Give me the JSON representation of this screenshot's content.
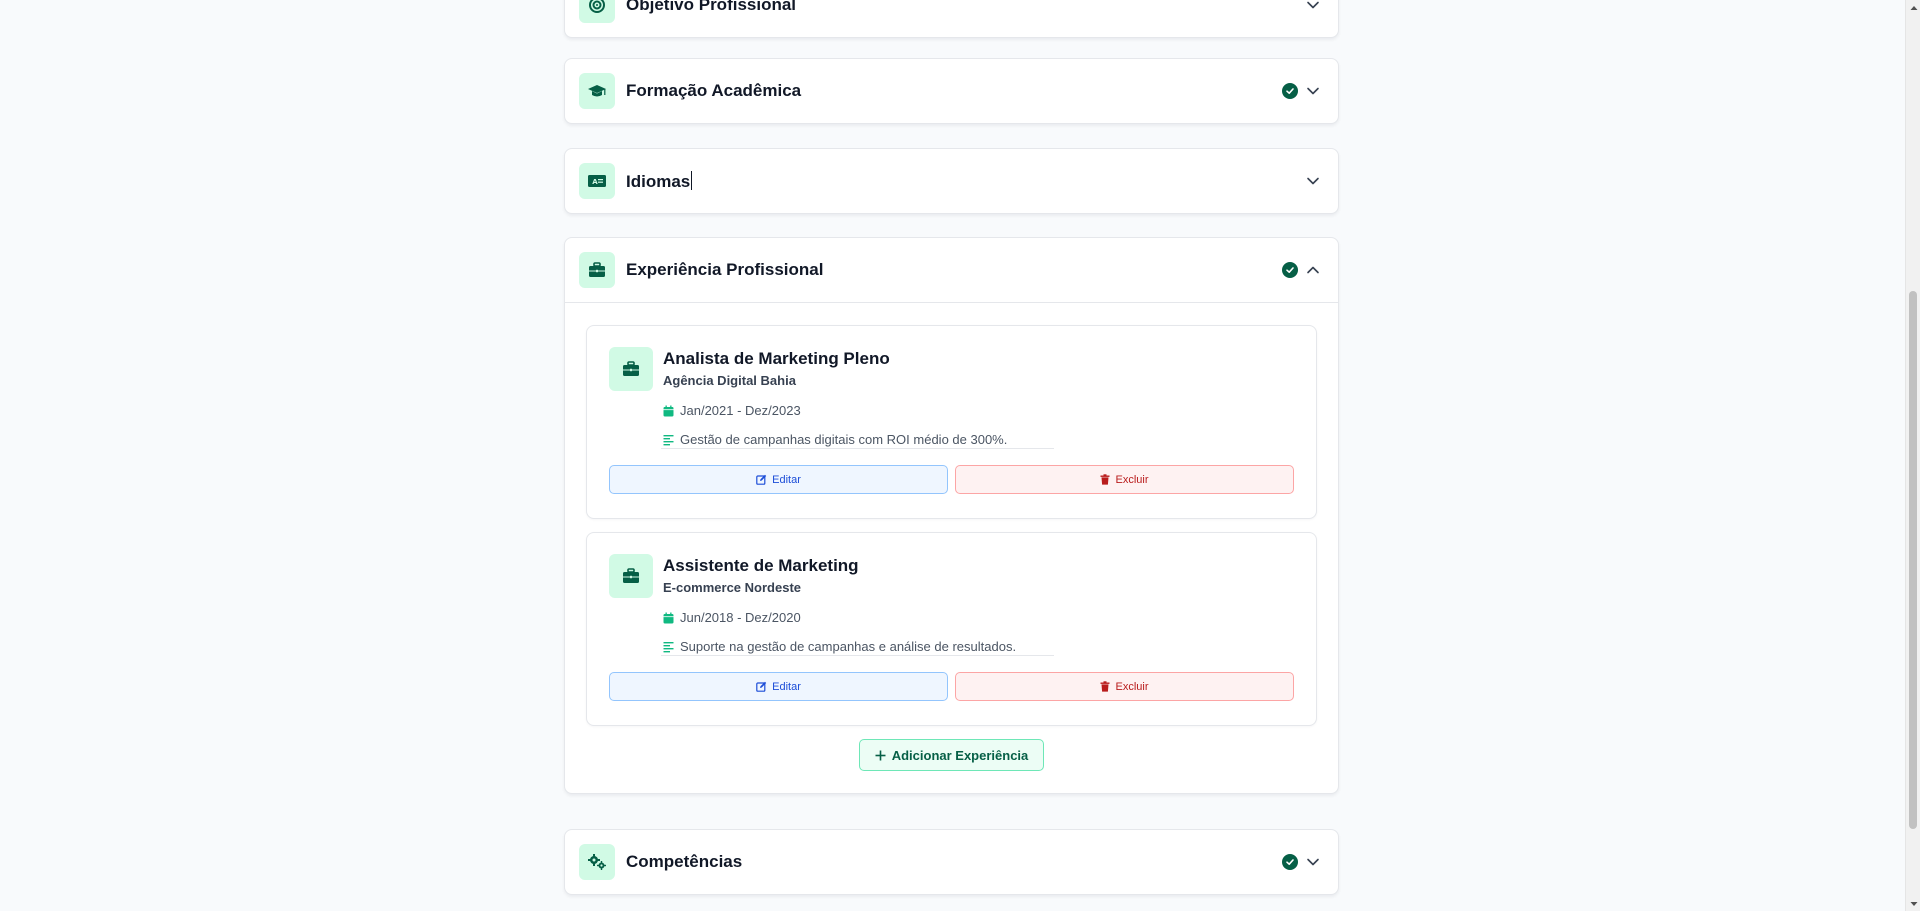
{
  "sections": {
    "objetivo": {
      "title": "Objetivo Profissional",
      "icon": "bullseye-icon"
    },
    "formacao": {
      "title": "Formação Acadêmica",
      "icon": "graduation-cap-icon",
      "completed": true
    },
    "idiomas": {
      "title": "Idiomas",
      "icon": "language-icon"
    },
    "experiencia": {
      "title": "Experiência Profissional",
      "icon": "briefcase-icon",
      "completed": true,
      "expanded": true,
      "items": [
        {
          "title": "Analista de Marketing Pleno",
          "company": "Agência Digital Bahia",
          "period": "Jan/2021 - Dez/2023",
          "description": "Gestão de campanhas digitais com ROI médio de 300%.",
          "edit_label": "Editar",
          "delete_label": "Excluir"
        },
        {
          "title": "Assistente de Marketing",
          "company": "E-commerce Nordeste",
          "period": "Jun/2018 - Dez/2020",
          "description": "Suporte na gestão de campanhas e análise de resultados.",
          "edit_label": "Editar",
          "delete_label": "Excluir"
        }
      ],
      "add_label": "Adicionar Experiência"
    },
    "competencias": {
      "title": "Competências",
      "icon": "gears-icon",
      "completed": true
    }
  },
  "colors": {
    "accent": "#065f46",
    "icon_bg": "#d1fae5",
    "edit_bg": "#eff6ff",
    "edit_border": "#93c5fd",
    "delete_bg": "#fef2f2",
    "delete_border": "#fca5a5"
  }
}
